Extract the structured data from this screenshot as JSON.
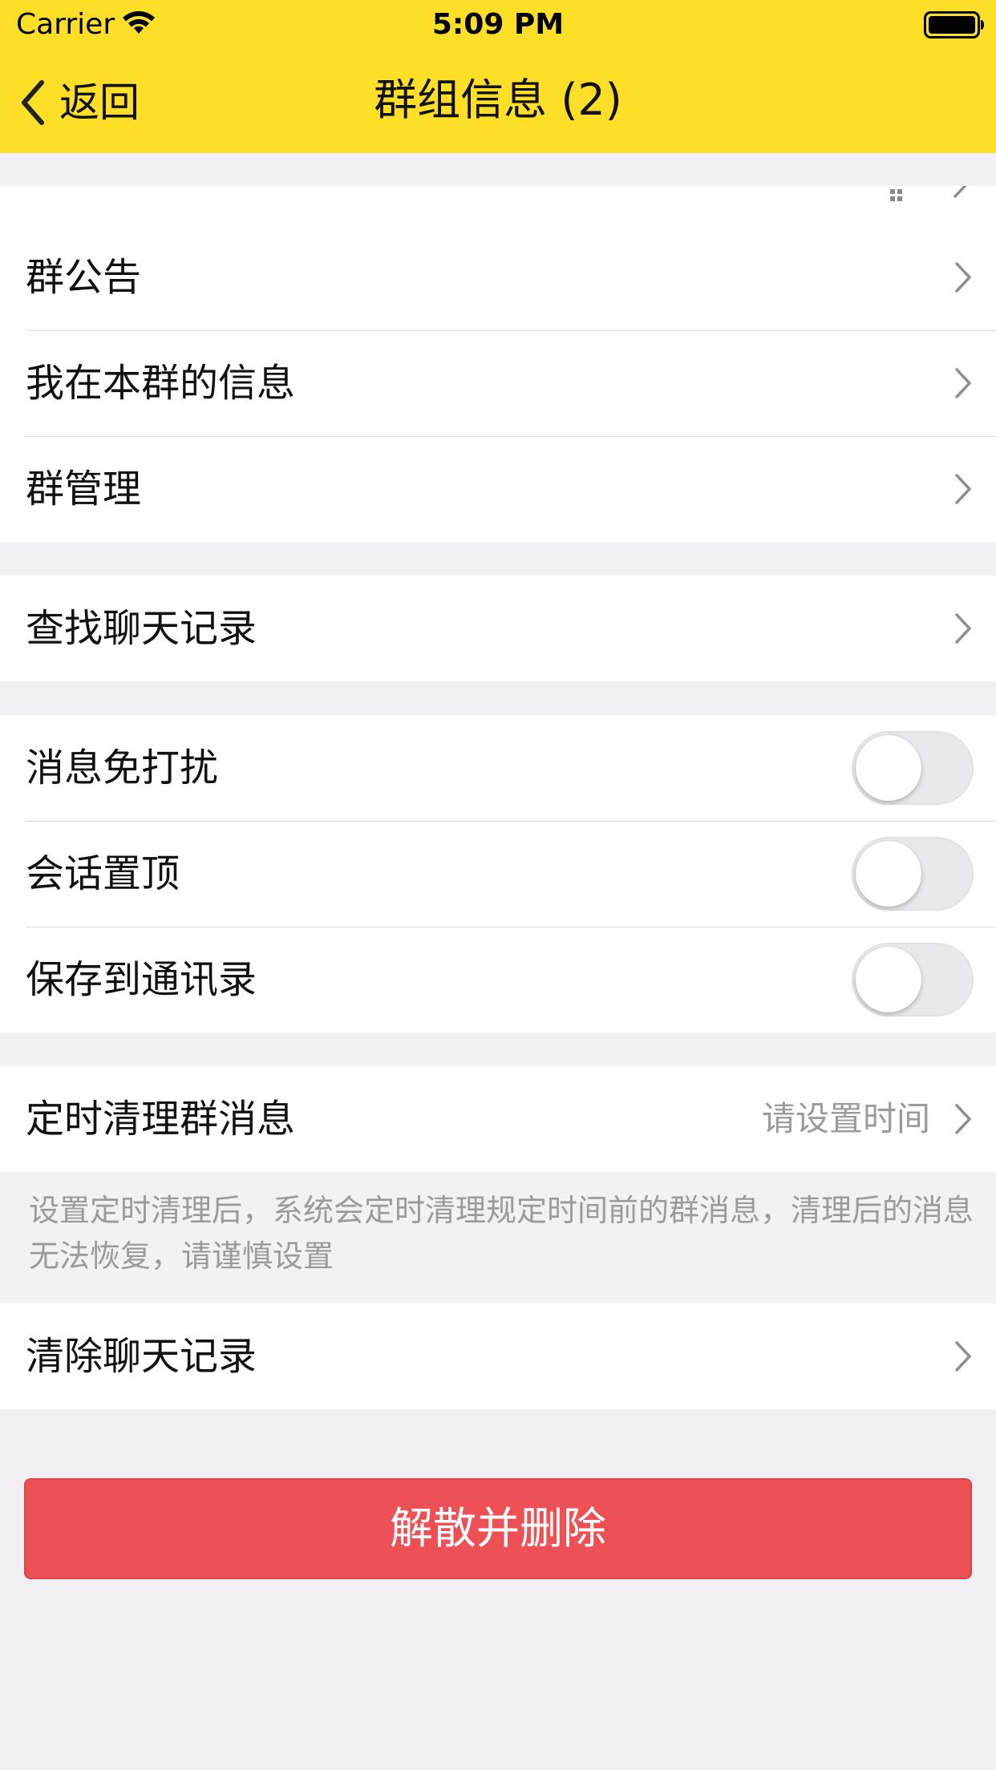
{
  "status_bar": {
    "carrier": "Carrier",
    "time": "5:09 PM"
  },
  "nav": {
    "back_label": "返回",
    "title": "群组信息 (2)"
  },
  "groups": {
    "info": [
      {
        "label": "群公告"
      },
      {
        "label": "我在本群的信息"
      },
      {
        "label": "群管理"
      }
    ],
    "search": [
      {
        "label": "查找聊天记录"
      }
    ],
    "toggles": [
      {
        "label": "消息免打扰",
        "on": false
      },
      {
        "label": "会话置顶",
        "on": false
      },
      {
        "label": "保存到通讯录",
        "on": false
      }
    ],
    "timed_clean": {
      "label": "定时清理群消息",
      "value": "请设置时间"
    },
    "note": "设置定时清理后，系统会定时清理规定时间前的群消息，清理后的消息无法恢复，请谨慎设置",
    "clear": {
      "label": "清除聊天记录"
    }
  },
  "danger_button": {
    "label": "解散并删除"
  },
  "colors": {
    "nav_background": "#fddf28",
    "page_background": "#efeff4",
    "danger": "#ed5155",
    "secondary_text": "#9b9b9b"
  }
}
